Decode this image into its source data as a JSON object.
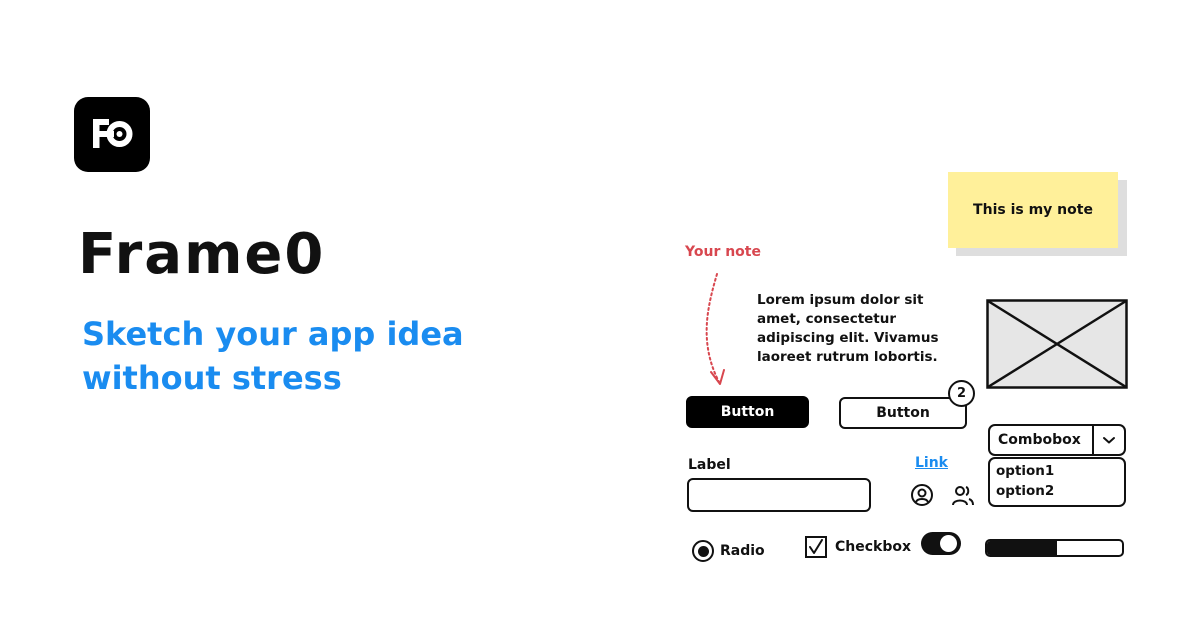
{
  "brand": {
    "logo_text": "FO",
    "title": "Frame0",
    "tagline": "Sketch your app idea without stress",
    "accent_color": "#1a8cf0"
  },
  "sketch": {
    "sticky_note": {
      "text": "This is my note",
      "color": "#fff09a"
    },
    "annotation": {
      "text": "Your note",
      "color": "#d8474f"
    },
    "paragraph": "Lorem ipsum dolor sit amet, consectetur adipiscing elit. Vivamus laoreet rutrum lobortis.",
    "image_placeholder": {
      "icon": "image-placeholder-icon"
    },
    "primary_button": {
      "label": "Button"
    },
    "secondary_button": {
      "label": "Button",
      "badge": "2"
    },
    "combobox": {
      "value": "Combobox",
      "options": [
        "option1",
        "option2"
      ]
    },
    "text_field": {
      "label": "Label",
      "value": "",
      "placeholder": ""
    },
    "link": {
      "text": "Link"
    },
    "icons": [
      "user-icon",
      "users-icon"
    ],
    "radio": {
      "label": "Radio",
      "checked": true
    },
    "checkbox": {
      "label": "Checkbox",
      "checked": true
    },
    "toggle": {
      "on": true
    },
    "progress": {
      "value": 0.52
    }
  }
}
